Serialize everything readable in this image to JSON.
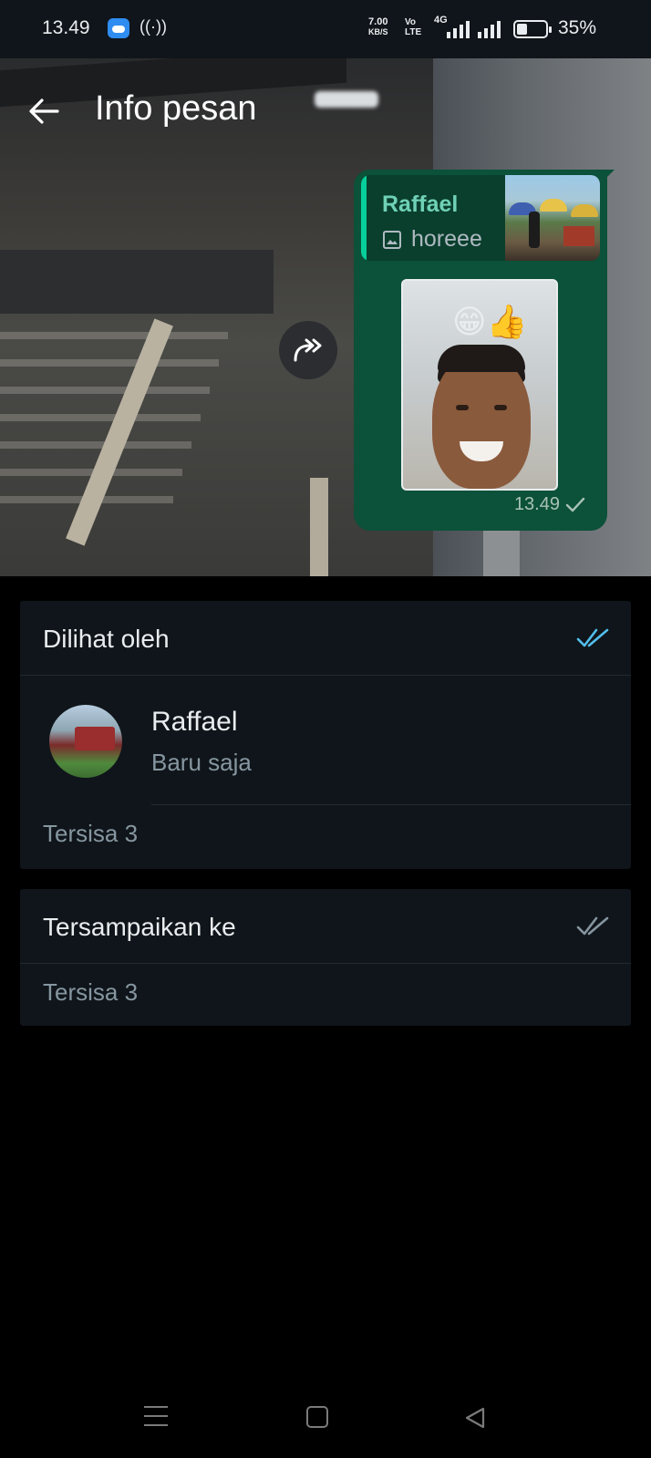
{
  "status_bar": {
    "time": "13.49",
    "speed_value": "7.00",
    "speed_unit": "KB/S",
    "volte_top": "Vo",
    "volte_bottom": "LTE",
    "network": "4G",
    "battery": "35%"
  },
  "header": {
    "title": "Info pesan",
    "back_icon": "arrow-left-icon"
  },
  "message": {
    "quoted_sender": "Raffael",
    "quoted_text": "horeee",
    "quoted_type_icon": "image-icon",
    "photo_emojis": "😁👍",
    "time": "13.49",
    "status_icon": "single-check-icon",
    "bubble_color": "#0c5139",
    "quote_accent": "#06cf9c"
  },
  "read_card": {
    "title": "Dilihat oleh",
    "tick_color": "#53bdeb",
    "contact": {
      "name": "Raffael",
      "time": "Baru saja"
    },
    "remaining": "Tersisa 3"
  },
  "delivered_card": {
    "title": "Tersampaikan ke",
    "tick_color": "#8696a0",
    "remaining": "Tersisa 3"
  }
}
